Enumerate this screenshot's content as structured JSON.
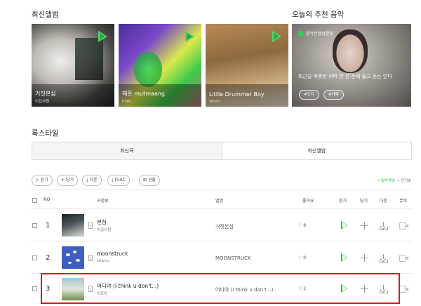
{
  "sections": {
    "latest_albums_title": "최신앨범",
    "recommend_title": "오늘의 추천 음악",
    "rockstyle_title": "록스타일"
  },
  "albums": [
    {
      "title": "거짓본심",
      "artist": "이십사원"
    },
    {
      "title": "헤픈 mutmaang",
      "artist": "PIRA"
    },
    {
      "title": "Little Drummer Boy",
      "artist": "Woshi"
    }
  ],
  "recommend": {
    "logo_text": "음악은항상곁에",
    "text": "퇴근길 따뜻한 커피 한 잔 손에 들고 듣는 인디",
    "tags": [
      "#인디",
      "#카페"
    ]
  },
  "tabs": [
    "최신곡",
    "최신앨범"
  ],
  "actions": [
    "듣기",
    "담기",
    "다운",
    "FLAC",
    "선물"
  ],
  "action_icons": [
    "play-outline-icon",
    "plus-icon",
    "download-icon",
    "download-icon",
    "gift-icon"
  ],
  "sort": {
    "popular": "• 밀마켓순",
    "name": "• 인기순"
  },
  "table_headers": {
    "no": "NO",
    "song_info": "곡정보",
    "album": "앨범",
    "likes": "좋아요",
    "listen": "듣기",
    "add": "담기",
    "download": "다운",
    "mv": "뮤비"
  },
  "songs": [
    {
      "rank": "1",
      "title": "본심",
      "artist": "이십사원",
      "album": "거짓본심",
      "likes": "♡ 8"
    },
    {
      "rank": "2",
      "title": "moonstruck",
      "artist": "shwnu",
      "album": "MOONSTRUCK",
      "likes": "♡ 0"
    },
    {
      "rank": "3",
      "title": "어디야 (I think u don't...)",
      "artist": "이로라",
      "album": "어디야 (I think u don't...)",
      "likes": "♡ 2"
    }
  ],
  "colors": {
    "accent_green": "#31c44a",
    "highlight_red": "#e0141d"
  }
}
